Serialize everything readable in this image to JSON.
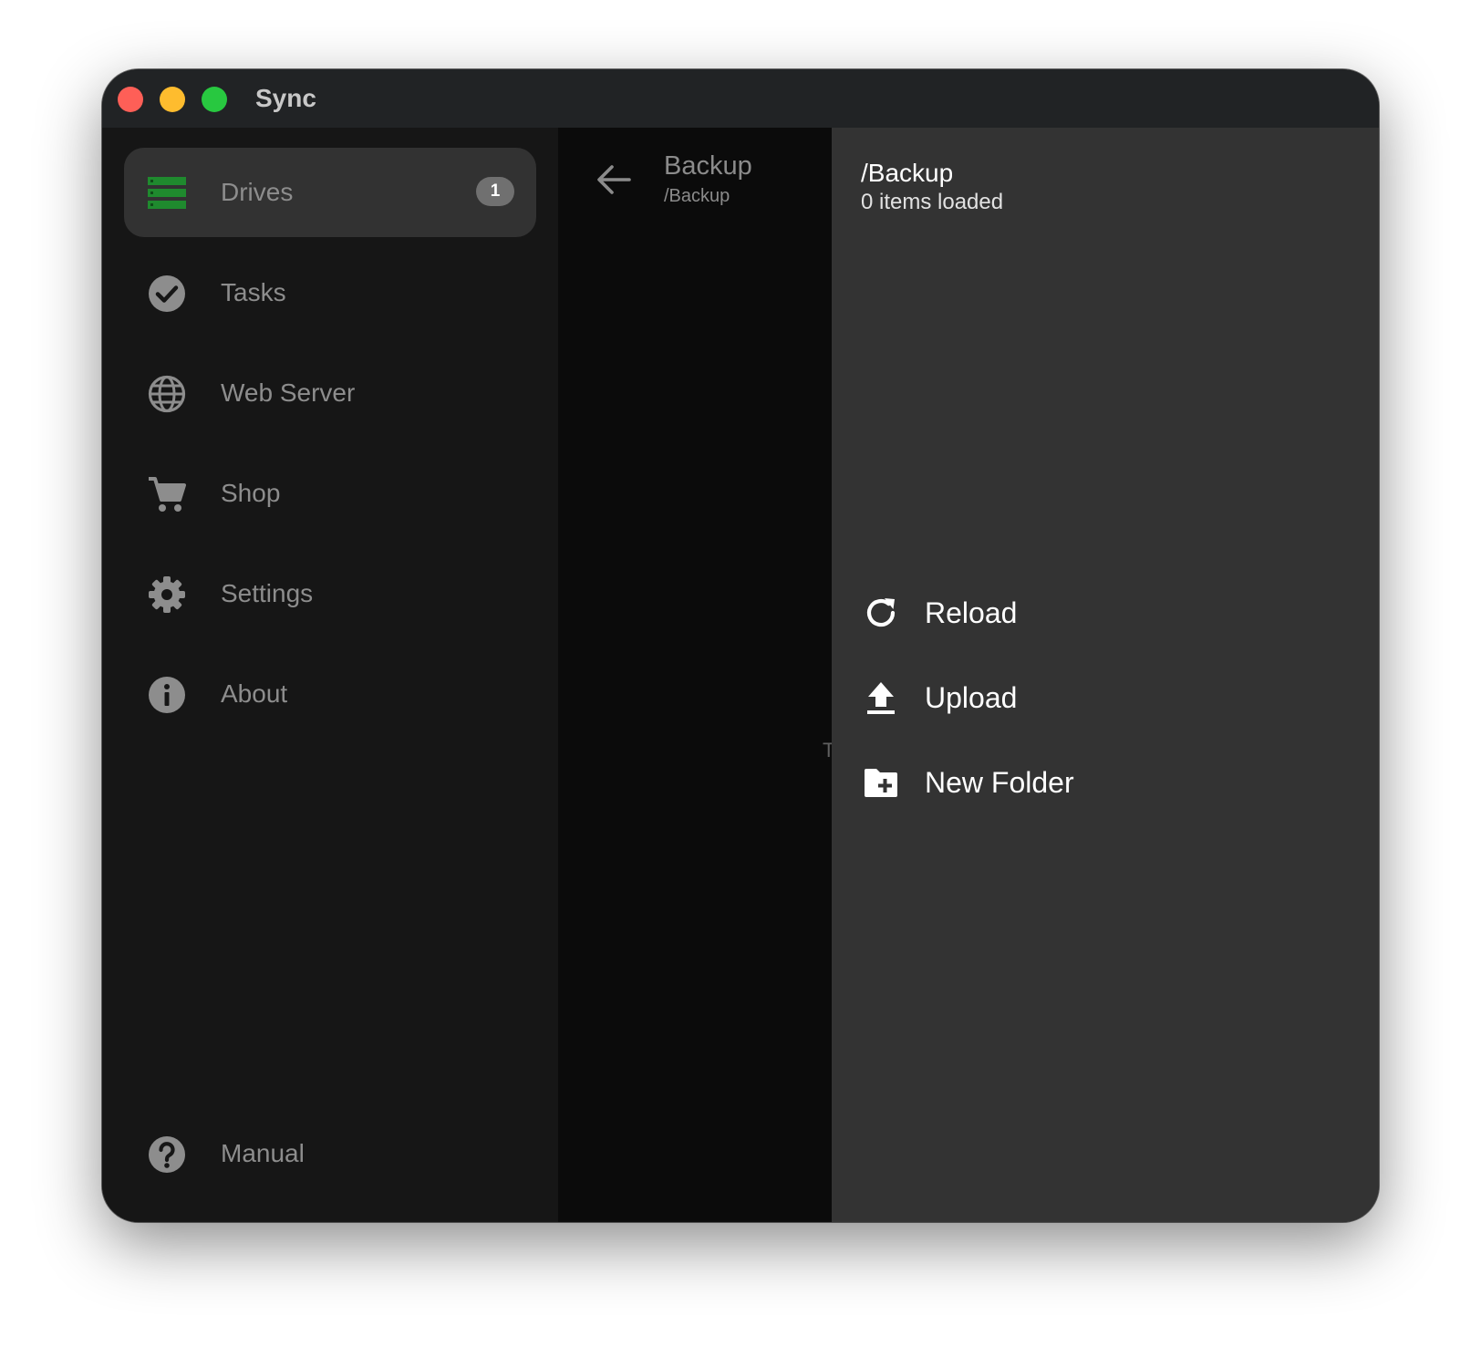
{
  "window": {
    "title": "Sync"
  },
  "sidebar": {
    "items": [
      {
        "label": "Drives",
        "icon": "drives-icon",
        "badge": "1",
        "active": true
      },
      {
        "label": "Tasks",
        "icon": "check-circle-icon"
      },
      {
        "label": "Web Server",
        "icon": "globe-icon"
      },
      {
        "label": "Shop",
        "icon": "cart-icon"
      },
      {
        "label": "Settings",
        "icon": "gear-icon"
      },
      {
        "label": "About",
        "icon": "info-icon"
      }
    ],
    "footer": {
      "label": "Manual",
      "icon": "help-icon"
    }
  },
  "browser": {
    "title": "Backup",
    "subtitle": "/Backup",
    "stray_text": "T"
  },
  "panel": {
    "path": "/Backup",
    "count": "0 items loaded",
    "actions": [
      {
        "label": "Reload",
        "icon": "reload-icon"
      },
      {
        "label": "Upload",
        "icon": "upload-icon"
      },
      {
        "label": "New Folder",
        "icon": "new-folder-icon"
      }
    ]
  },
  "colors": {
    "accent": "#1f8a2e",
    "sidebar_bg": "#161616",
    "middle_bg": "#0b0b0b",
    "panel_bg": "#333333"
  }
}
